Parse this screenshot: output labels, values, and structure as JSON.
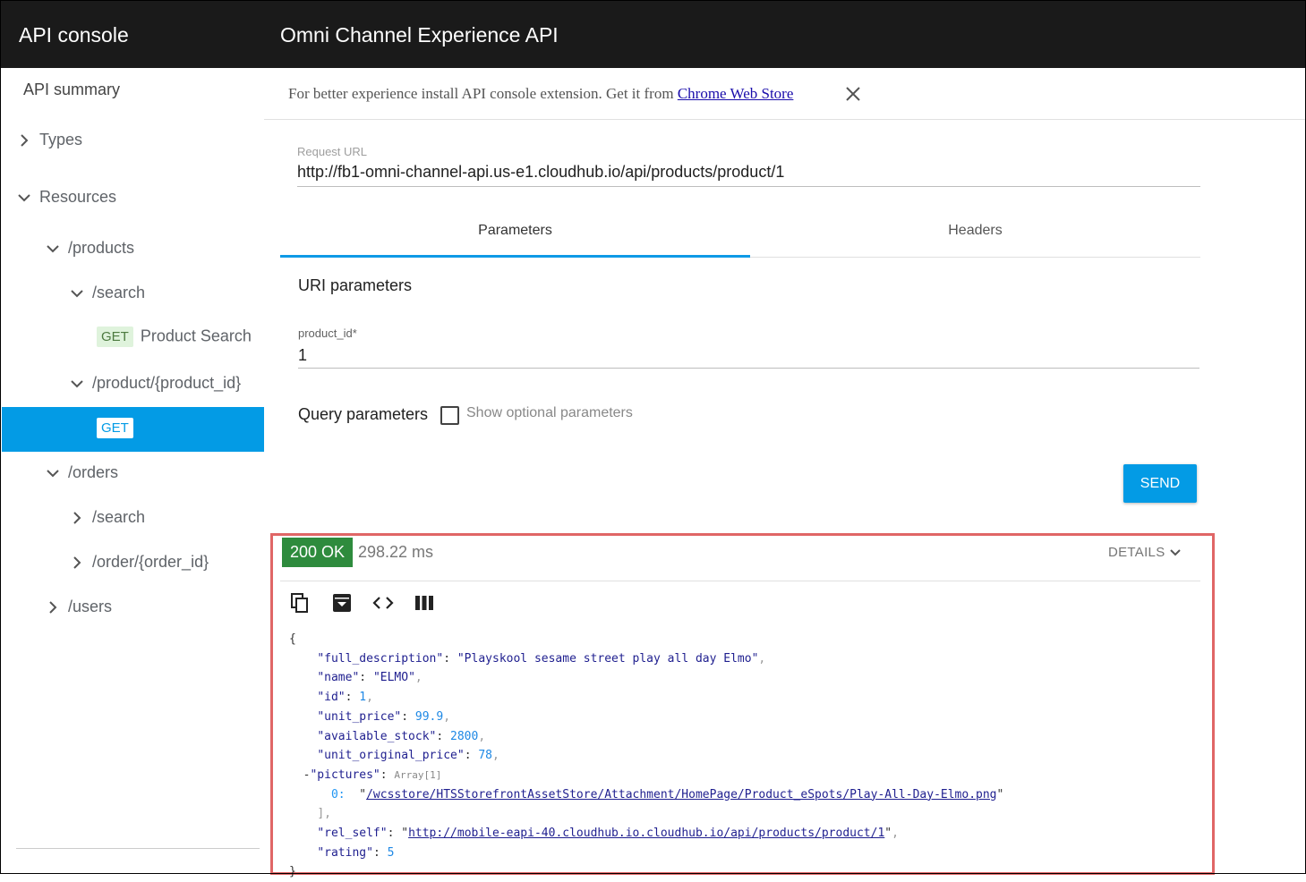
{
  "header": {
    "app_title": "API console",
    "api_title": "Omni Channel Experience API"
  },
  "sidebar": {
    "summary": "API summary",
    "types": "Types",
    "resources": "Resources",
    "products": "/products",
    "products_search": "/search",
    "product_search_method": "GET",
    "product_search_label": "Product Search",
    "product_id": "/product/{product_id}",
    "product_get_method": "GET",
    "orders": "/orders",
    "orders_search": "/search",
    "order_id": "/order/{order_id}",
    "users": "/users"
  },
  "banner": {
    "text": "For better experience install API console extension. Get it from ",
    "link": "Chrome Web Store"
  },
  "request": {
    "url_label": "Request URL",
    "url": "http://fb1-omni-channel-api.us-e1.cloudhub.io/api/products/product/1"
  },
  "tabs": {
    "parameters": "Parameters",
    "headers": "Headers"
  },
  "params": {
    "uri_title": "URI parameters",
    "product_id_label": "product_id*",
    "product_id_value": "1",
    "query_title": "Query parameters",
    "optional_label": "Show optional parameters"
  },
  "send_label": "SEND",
  "response": {
    "status": "200 OK",
    "time": "298.22 ms",
    "details": "DETAILS",
    "json": {
      "open": "{",
      "k_full_description": "\"full_description\"",
      "v_full_description": "\"Playskool sesame street play all day Elmo\"",
      "k_name": "\"name\"",
      "v_name": "\"ELMO\"",
      "k_id": "\"id\"",
      "v_id": "1",
      "k_unit_price": "\"unit_price\"",
      "v_unit_price": "99.9",
      "k_available_stock": "\"available_stock\"",
      "v_available_stock": "2800",
      "k_unit_original_price": "\"unit_original_price\"",
      "v_unit_original_price": "78",
      "k_pictures": "\"pictures\"",
      "pictures_meta": "Array[1]",
      "pictures_index": "0:",
      "v_picture": "/wcsstore/HTSStorefrontAssetStore/Attachment/HomePage/Product_eSpots/Play-All-Day-Elmo.png",
      "pictures_close": "],",
      "k_rel_self": "\"rel_self\"",
      "v_rel_self": "http://mobile-eapi-40.cloudhub.io.cloudhub.io/api/products/product/1",
      "k_rating": "\"rating\"",
      "v_rating": "5",
      "close": "}"
    }
  }
}
